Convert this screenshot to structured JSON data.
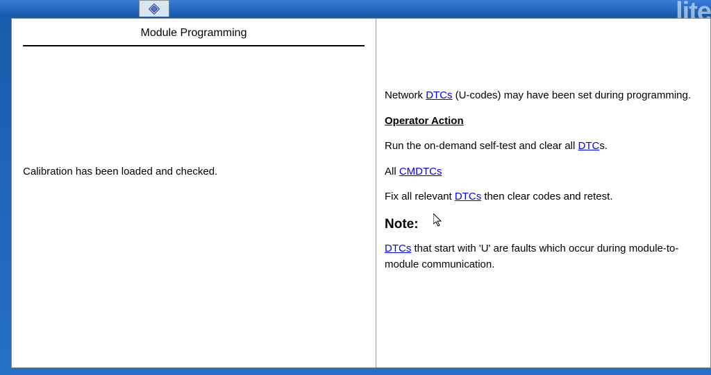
{
  "watermark": "lite",
  "left_panel": {
    "title": "Module Programming",
    "status": "Calibration has been loaded and checked."
  },
  "right_panel": {
    "line1_pre": "Network ",
    "line1_link": "DTCs",
    "line1_post": " (U-codes) may have been set during programming.",
    "operator_heading": "Operator Action",
    "line2_pre": "Run the on-demand self-test and clear all ",
    "line2_link": "DTC",
    "line2_post": "s.",
    "line3_pre": "All ",
    "line3_link": "CMDTCs",
    "line4_pre": "Fix all relevant ",
    "line4_link": "DTCs",
    "line4_post": " then clear codes and retest.",
    "note_heading": "Note:",
    "note_link": "DTCs",
    "note_post": " that start with 'U' are faults which occur during module-to-module communication."
  }
}
